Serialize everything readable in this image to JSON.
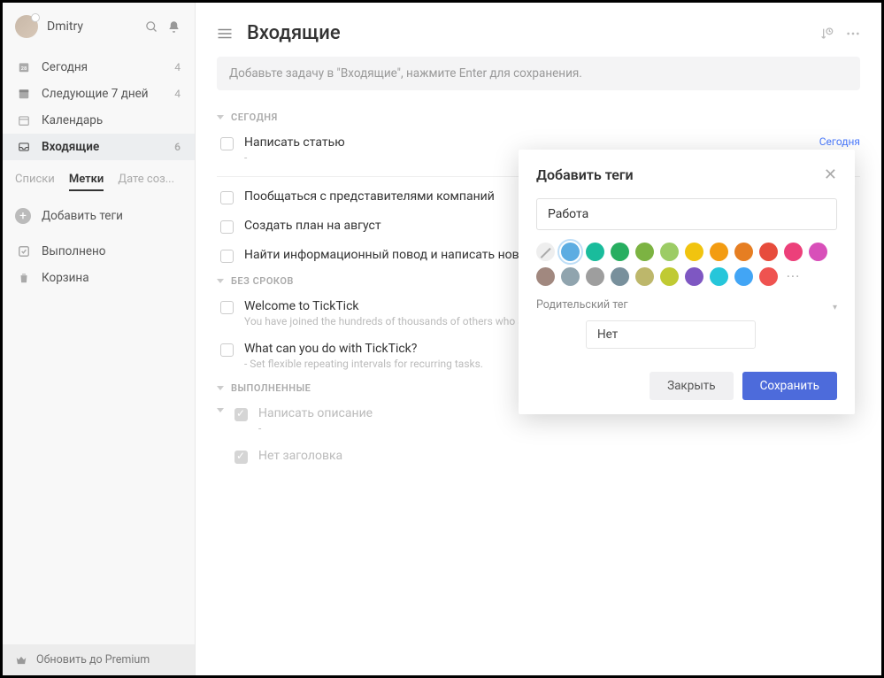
{
  "user": {
    "name": "Dmitry"
  },
  "nav": {
    "today": {
      "label": "Сегодня",
      "count": "4"
    },
    "next7": {
      "label": "Следующие 7 дней",
      "count": "4"
    },
    "calendar": {
      "label": "Календарь"
    },
    "inbox": {
      "label": "Входящие",
      "count": "6"
    }
  },
  "tabs": {
    "lists": "Списки",
    "tags": "Метки",
    "custom": "Дате соз..."
  },
  "add_tags_label": "Добавить теги",
  "completed_label": "Выполнено",
  "trash_label": "Корзина",
  "premium_label": "Обновить до Premium",
  "main": {
    "title": "Входящие",
    "input_placeholder": "Добавьте задачу в \"Входящие\", нажмите Enter для сохранения."
  },
  "sections": {
    "today": "СЕГОДНЯ",
    "nodate": "БЕЗ СРОКОВ",
    "done": "ВЫПОЛНЕННЫЕ"
  },
  "tasks": {
    "today": [
      {
        "title": "Написать статью",
        "sub": "-",
        "due": "Сегодня"
      },
      {
        "title": "Пообщаться с представителями компаний"
      },
      {
        "title": "Создать план на август"
      },
      {
        "title": "Найти информационный повод и написать новость"
      }
    ],
    "nodate": [
      {
        "title": "Welcome to TickTick",
        "sub": "You have joined the hundreds of thousands of others who are using"
      },
      {
        "title": "What can you do with TickTick?",
        "sub": "- Set flexible repeating intervals for recurring tasks."
      }
    ],
    "done": [
      {
        "title": "Написать описание",
        "sub": "-"
      },
      {
        "title": "Нет заголовка"
      }
    ]
  },
  "dialog": {
    "title": "Добавить теги",
    "tag_value": "Работа",
    "parent_label": "Родительский тег",
    "parent_value": "Нет",
    "close": "Закрыть",
    "save": "Сохранить",
    "colors": [
      "#5dade2",
      "#1abc9c",
      "#27ae60",
      "#7cb342",
      "#9ccc65",
      "#f1c40f",
      "#f39c12",
      "#e67e22",
      "#e74c3c",
      "#ec407a",
      "#d84fb9",
      "#a1887f",
      "#90a4ae",
      "#9e9e9e",
      "#78909c",
      "#bdb76b"
    ],
    "colors2": [
      "#c0ca33",
      "#7e57c2",
      "#26c6da",
      "#42a5f5",
      "#ef5350"
    ]
  }
}
